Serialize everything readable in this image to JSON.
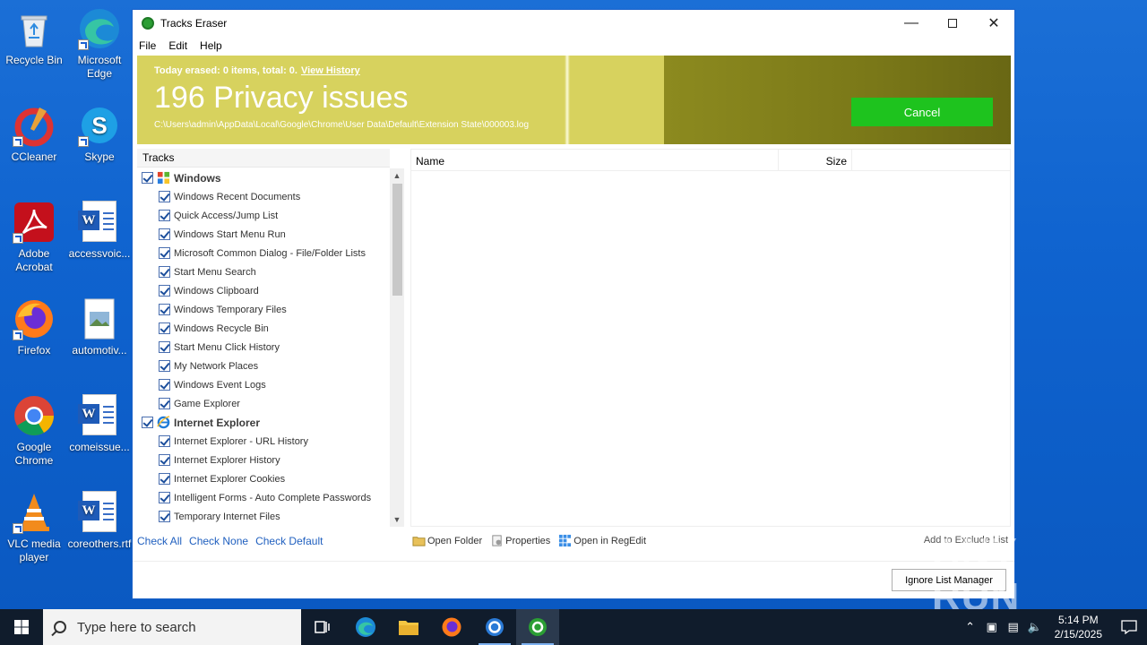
{
  "desktop": {
    "icons": [
      {
        "label": "Recycle Bin"
      },
      {
        "label": "Microsoft Edge"
      },
      {
        "label": "CCleaner"
      },
      {
        "label": "Skype"
      },
      {
        "label": "Adobe Acrobat"
      },
      {
        "label": "accessvoic..."
      },
      {
        "label": "Firefox"
      },
      {
        "label": "automotiv..."
      },
      {
        "label": "Google Chrome"
      },
      {
        "label": "comeissue..."
      },
      {
        "label": "VLC media player"
      },
      {
        "label": "coreothers.rtf"
      }
    ]
  },
  "window": {
    "title": "Tracks Eraser",
    "menu": [
      "File",
      "Edit",
      "Help"
    ],
    "banner": {
      "today": "Today erased: 0 items, total: 0.",
      "view_history": "View History",
      "issues": "196 Privacy issues",
      "path": "C:\\Users\\admin\\AppData\\Local\\Google\\Chrome\\User Data\\Default\\Extension State\\000003.log",
      "cancel": "Cancel"
    },
    "tracks": {
      "header": "Tracks",
      "groups": [
        {
          "name": "Windows",
          "items": [
            "Windows Recent Documents",
            "Quick Access/Jump List",
            "Windows Start Menu Run",
            "Microsoft Common Dialog - File/Folder Lists",
            "Start Menu Search",
            "Windows Clipboard",
            "Windows Temporary Files",
            "Windows Recycle Bin",
            "Start Menu Click History",
            "My Network Places",
            "Windows Event Logs",
            "Game Explorer"
          ]
        },
        {
          "name": "Internet Explorer",
          "items": [
            "Internet Explorer - URL History",
            "Internet Explorer History",
            "Internet Explorer Cookies",
            "Intelligent Forms - Auto Complete Passwords",
            "Temporary Internet Files"
          ]
        }
      ]
    },
    "list": {
      "col_name": "Name",
      "col_size": "Size"
    },
    "links": {
      "check_all": "Check All",
      "check_none": "Check None",
      "check_default": "Check Default"
    },
    "actions": {
      "open_folder": "Open Folder",
      "properties": "Properties",
      "open_regedit": "Open in RegEdit"
    },
    "exclude": "Add to Exclude List",
    "ignore_manager": "Ignore List Manager"
  },
  "watermark": "ANY RUN",
  "taskbar": {
    "search_placeholder": "Type here to search",
    "time": "5:14 PM",
    "date": "2/15/2025"
  },
  "colors": {
    "banner": "#d7d25e",
    "banner_dark": "#7a7818",
    "cancel": "#1ec31e",
    "desktop": "#0f63cf",
    "taskbar": "#101c2c",
    "link": "#1f5fbf"
  }
}
